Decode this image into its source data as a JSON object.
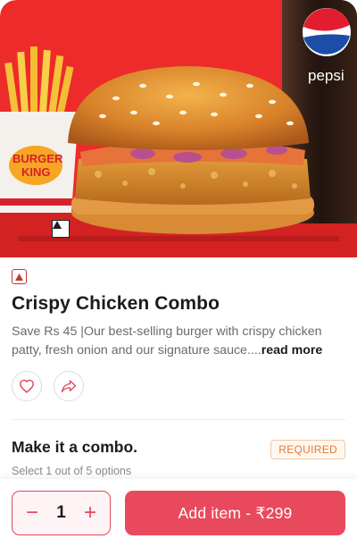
{
  "hero": {
    "brand_logo_text_1": "BURGER",
    "brand_logo_text_2": "KING",
    "drink_label": "pepsi"
  },
  "item": {
    "veg_marker": "non-veg-icon",
    "title": "Crispy Chicken Combo",
    "description": "Save Rs 45 |Our best-selling burger with crispy chicken patty, fresh onion and our signature sauce....",
    "read_more": "read more"
  },
  "actions": {
    "favorite_icon": "heart-icon",
    "share_icon": "share-icon"
  },
  "combo": {
    "title": "Make it a combo.",
    "subtitle": "Select 1 out of 5 options",
    "badge": "REQUIRED"
  },
  "footer": {
    "decrement": "−",
    "quantity": "1",
    "increment": "+",
    "add_label": "Add item - ₹299"
  },
  "colors": {
    "hero_bg": "#ee2b2b",
    "accent": "#e9495d",
    "required_text": "#e8772e"
  }
}
